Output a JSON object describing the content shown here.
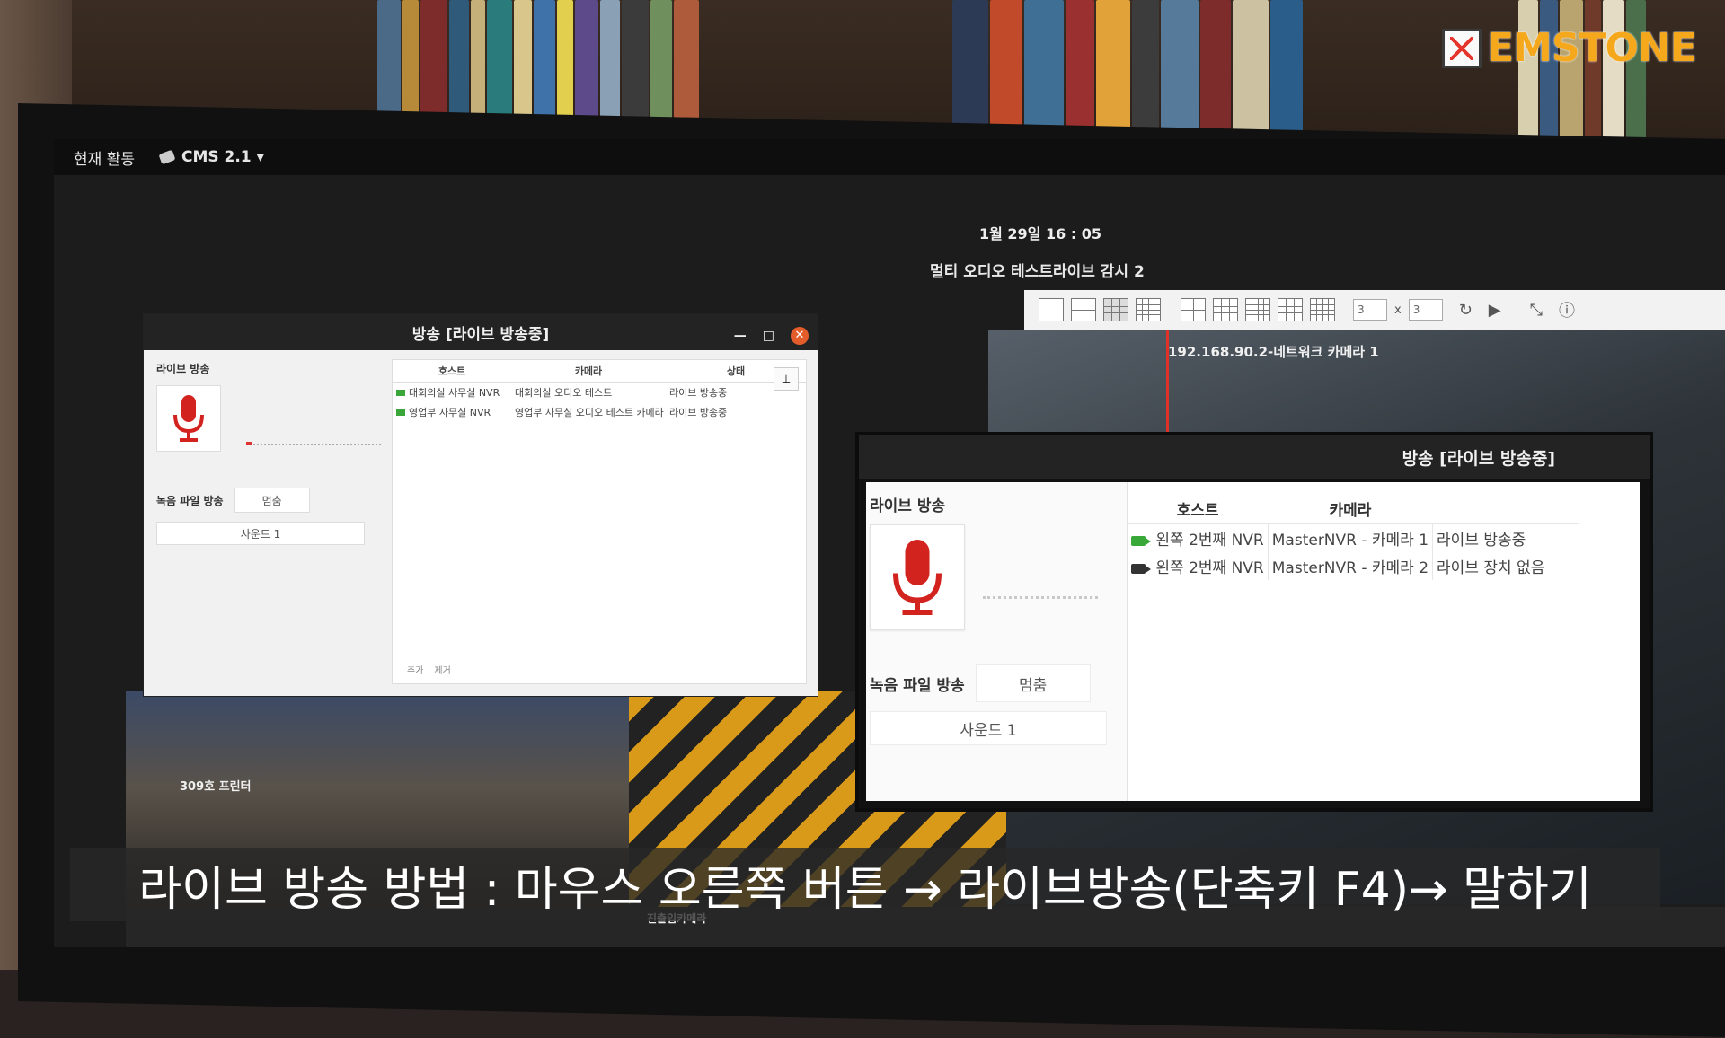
{
  "brand": {
    "name": "EMSTONE",
    "accent": "#f5a81c"
  },
  "desktop": {
    "activities": "현재 활동",
    "app_menu": "CMS 2.1 ▾",
    "clock": "1월 29일 16 : 05"
  },
  "monitor": {
    "title": "멀티 오디오 테스트라이브 감시 2",
    "toolbar": {
      "split_count": "3",
      "split_x": "x",
      "split_rows": "3",
      "icons": [
        "single-layout-icon",
        "grid-4-icon",
        "grid-9-icon",
        "grid-16-icon",
        "layout-custom-icon",
        "refresh-icon",
        "play-icon",
        "fullscreen-icon",
        "info-icon"
      ]
    },
    "feeds": [
      {
        "label": "192.168.90.2-네트워크 카메라 1"
      },
      {
        "label": "309호 프린터"
      },
      {
        "label": "진출입카메라"
      }
    ]
  },
  "dialog": {
    "title": "방송 [라이브 방송중]",
    "live_label": "라이브 방송",
    "record_label": "녹음 파일 방송",
    "stop_button": "멈춤",
    "sound_field": "사운드 1",
    "columns": [
      "호스트",
      "카메라",
      "상태"
    ],
    "rows": [
      {
        "host": "대회의실 사무실 NVR",
        "camera": "대회의실 오디오 테스트",
        "status": "라이브 방송중"
      },
      {
        "host": "영업부 사무실 NVR",
        "camera": "영업부 사무실 오디오 테스트 카메라",
        "status": "라이브 방송중"
      }
    ],
    "add_button": "추가",
    "remove_button": "제거"
  },
  "inset": {
    "title": "방송 [라이브 방송중]",
    "live_label": "라이브 방송",
    "record_label": "녹음 파일 방송",
    "stop_button": "멈춤",
    "sound_field": "사운드 1",
    "columns": [
      "호스트",
      "카메라",
      ""
    ],
    "rows": [
      {
        "host": "왼쪽 2번째 NVR",
        "camera": "MasterNVR - 카메라 1",
        "status": "라이브 방송중",
        "active": true
      },
      {
        "host": "왼쪽 2번째 NVR",
        "camera": "MasterNVR - 카메라 2",
        "status": "라이브 장치 없음",
        "active": false
      }
    ]
  },
  "caption": "라이브 방송 방법 : 마우스 오른쪽 버튼 → 라이브방송(단축키 F4)→ 말하기"
}
